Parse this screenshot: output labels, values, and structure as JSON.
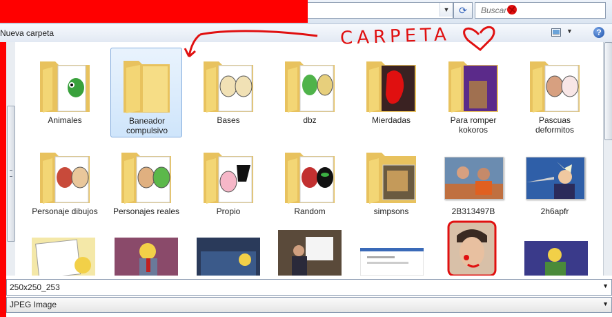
{
  "addressbar": {
    "search_placeholder": "Buscar",
    "dropdown_glyph": "▼",
    "refresh_glyph": "⟳"
  },
  "toolbar": {
    "new_folder": "Nueva carpeta",
    "view_dropdown_glyph": "▼",
    "help_glyph": "?"
  },
  "annotation": {
    "text": "CARPETA"
  },
  "folders": [
    {
      "label": "Animales",
      "selected": false
    },
    {
      "label": "Baneador compulsivo",
      "selected": true
    },
    {
      "label": "Bases",
      "selected": false
    },
    {
      "label": "dbz",
      "selected": false
    },
    {
      "label": "Mierdadas",
      "selected": false
    },
    {
      "label": "Para romper kokoros",
      "selected": false
    },
    {
      "label": "Pascuas deformitos",
      "selected": false
    },
    {
      "label": "Personaje dibujos",
      "selected": false
    },
    {
      "label": "Personajes reales",
      "selected": false
    },
    {
      "label": "Propio",
      "selected": false
    },
    {
      "label": "Random",
      "selected": false
    },
    {
      "label": "simpsons",
      "selected": false
    }
  ],
  "images": [
    {
      "label": "2B313497B"
    },
    {
      "label": "2h6apfr"
    }
  ],
  "footer": {
    "filename": "250x250_253",
    "filetype": "JPEG Image",
    "dropdown_glyph": "▼"
  },
  "colors": {
    "redaction": "#ff0000",
    "selection": "#cfe5fb",
    "folder": "#f3d675"
  }
}
